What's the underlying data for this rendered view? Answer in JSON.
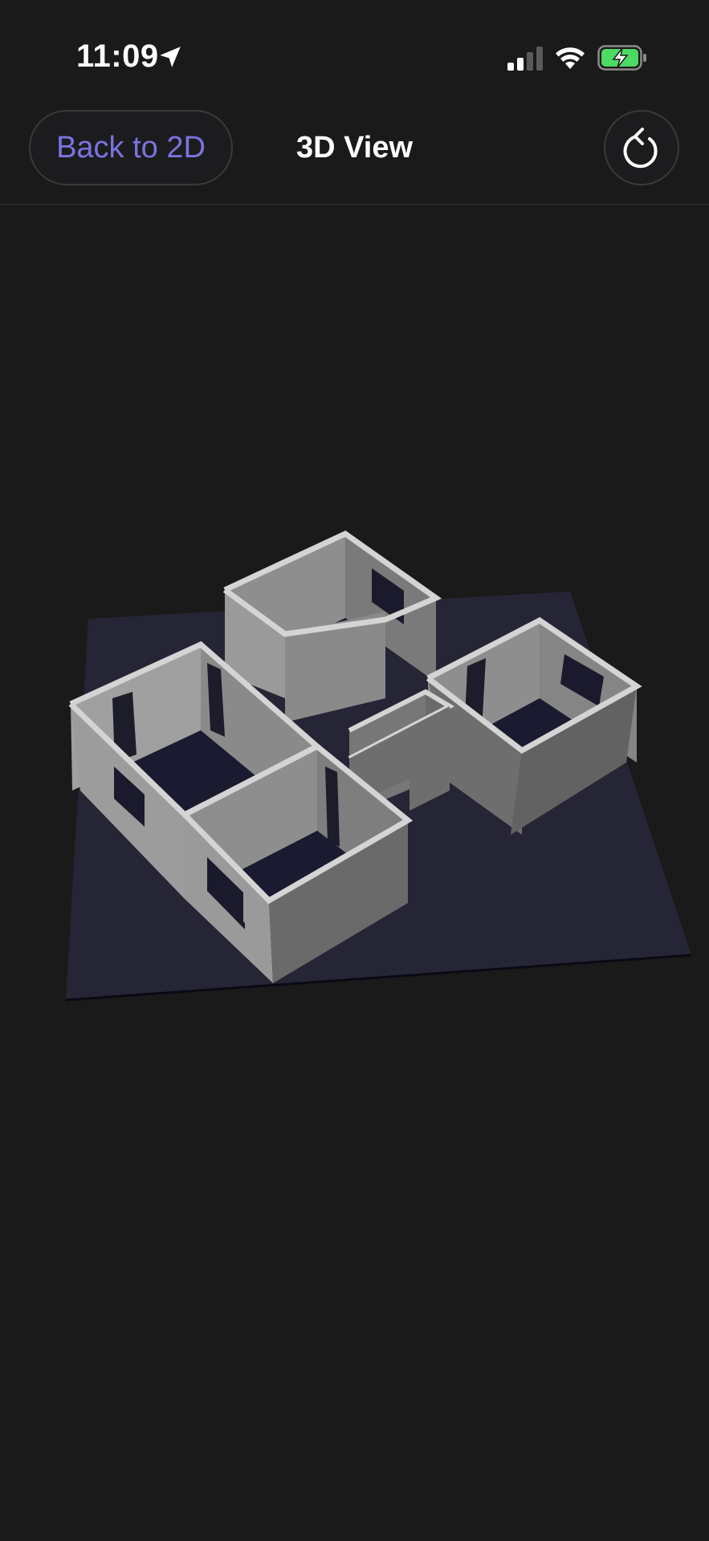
{
  "status_bar": {
    "time": "11:09",
    "location_icon": "location-arrow-icon",
    "signal_icon": "cellular-signal-icon",
    "wifi_icon": "wifi-icon",
    "battery_icon": "battery-charging-icon",
    "battery_color": "#4cd964"
  },
  "header": {
    "back_label": "Back to 2D",
    "title": "3D View",
    "reset_icon": "rotate-reset-icon"
  },
  "colors": {
    "background": "#1a1a1a",
    "accent": "#7b73e0",
    "floor": "#25253a",
    "wall_light": "#9a9a9a",
    "wall_dark": "#6a6a6a",
    "wall_top": "#d0d0d0",
    "room_floor": "#1a1a30"
  }
}
